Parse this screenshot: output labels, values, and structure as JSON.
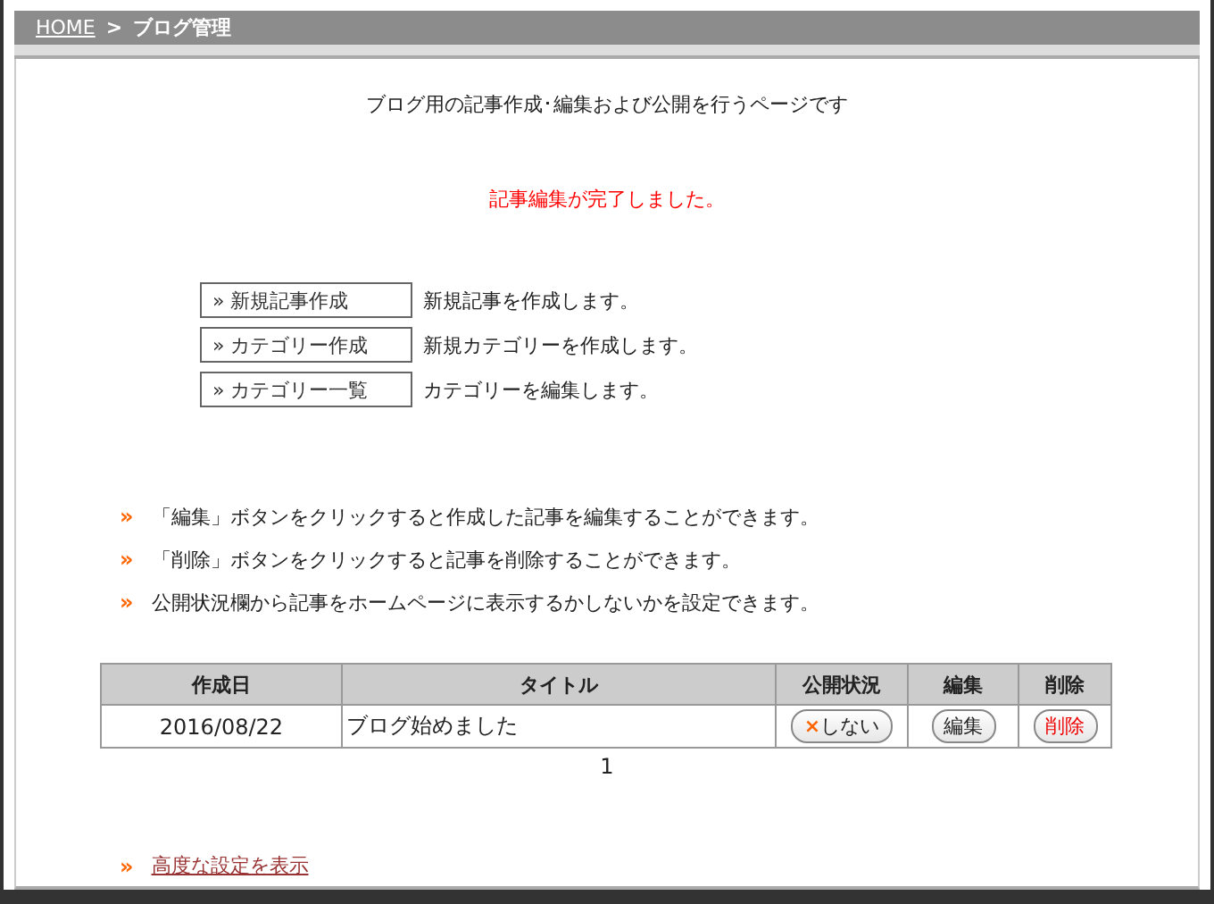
{
  "breadcrumb": {
    "home": "HOME",
    "separator": ">",
    "current": "ブログ管理"
  },
  "description": "ブログ用の記事作成･編集および公開を行うページです",
  "message": "記事編集が完了しました。",
  "actions": [
    {
      "label": "» 新規記事作成",
      "text": "新規記事を作成します。"
    },
    {
      "label": "» カテゴリー作成",
      "text": "新規カテゴリーを作成します。"
    },
    {
      "label": "» カテゴリー一覧",
      "text": "カテゴリーを編集します。"
    }
  ],
  "hints": [
    {
      "bullet": "»",
      "text": "「編集」ボタンをクリックすると作成した記事を編集することができます。"
    },
    {
      "bullet": "»",
      "text": "「削除」ボタンをクリックすると記事を削除することができます。"
    },
    {
      "bullet": "»",
      "text": "公開状況欄から記事をホームページに表示するかしないかを設定できます。"
    }
  ],
  "table": {
    "columns": [
      "作成日",
      "タイトル",
      "公開状況",
      "編集",
      "削除"
    ],
    "rows": [
      {
        "date": "2016/08/22",
        "title": "ブログ始めました",
        "status_icon": "×",
        "status": "しない",
        "edit": "編集",
        "delete": "削除"
      }
    ]
  },
  "pagination": [
    "1"
  ],
  "advanced_link": {
    "bullet": "»",
    "label": "高度な設定を表示"
  }
}
